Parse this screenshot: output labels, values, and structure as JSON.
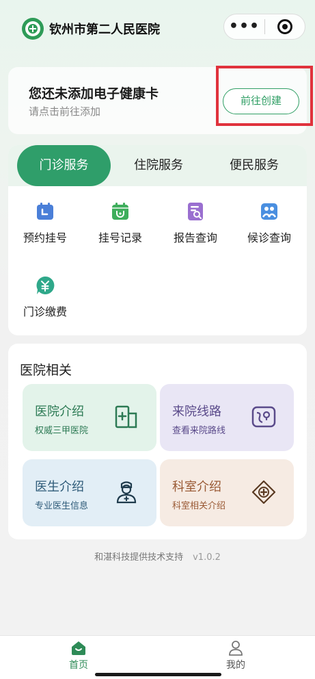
{
  "header": {
    "title": "钦州市第二人民医院",
    "logo_icon": "hospital-logo-icon",
    "more_icon": "more-dots-icon",
    "close_icon": "target-circle-icon",
    "more_glyph": "•••"
  },
  "health_card": {
    "title": "您还未添加电子健康卡",
    "subtitle": "请点击前往添加",
    "button_label": "前往创建",
    "highlight_color": "#e0323c"
  },
  "service_tabs": [
    {
      "label": "门诊服务",
      "active": true
    },
    {
      "label": "住院服务",
      "active": false
    },
    {
      "label": "便民服务",
      "active": false
    }
  ],
  "services": [
    {
      "label": "预约挂号",
      "icon": "calendar-icon",
      "color": "#4a7fd8"
    },
    {
      "label": "挂号记录",
      "icon": "calendar-stethoscope-icon",
      "color": "#3fae5c"
    },
    {
      "label": "报告查询",
      "icon": "report-search-icon",
      "color": "#9a6fd0"
    },
    {
      "label": "候诊查询",
      "icon": "waiting-queue-icon",
      "color": "#4a8fe0"
    },
    {
      "label": "门诊缴费",
      "icon": "yuan-payment-icon",
      "color": "#2fa88a"
    }
  ],
  "related": {
    "title": "医院相关",
    "cards": [
      {
        "title": "医院介绍",
        "subtitle": "权威三甲医院",
        "icon": "hospital-building-icon",
        "bg": "#e3f3ea",
        "color": "#2c7a54"
      },
      {
        "title": "来院线路",
        "subtitle": "查看来院路线",
        "icon": "map-route-icon",
        "bg": "#e9e6f5",
        "color": "#5a4a8a"
      },
      {
        "title": "医生介绍",
        "subtitle": "专业医生信息",
        "icon": "doctor-icon",
        "bg": "#e2eef6",
        "color": "#2d5a78"
      },
      {
        "title": "科室介绍",
        "subtitle": "科室相关介绍",
        "icon": "department-cross-icon",
        "bg": "#f6ebe3",
        "color": "#9a5a35"
      }
    ]
  },
  "footer": {
    "support": "和湛科技提供技术支持",
    "version": "v1.0.2"
  },
  "bottom_nav": [
    {
      "label": "首页",
      "icon": "home-icon",
      "active": true
    },
    {
      "label": "我的",
      "icon": "user-profile-icon",
      "active": false
    }
  ],
  "colors": {
    "brand_green": "#2f9e6a",
    "nav_active": "#2e8b57"
  }
}
